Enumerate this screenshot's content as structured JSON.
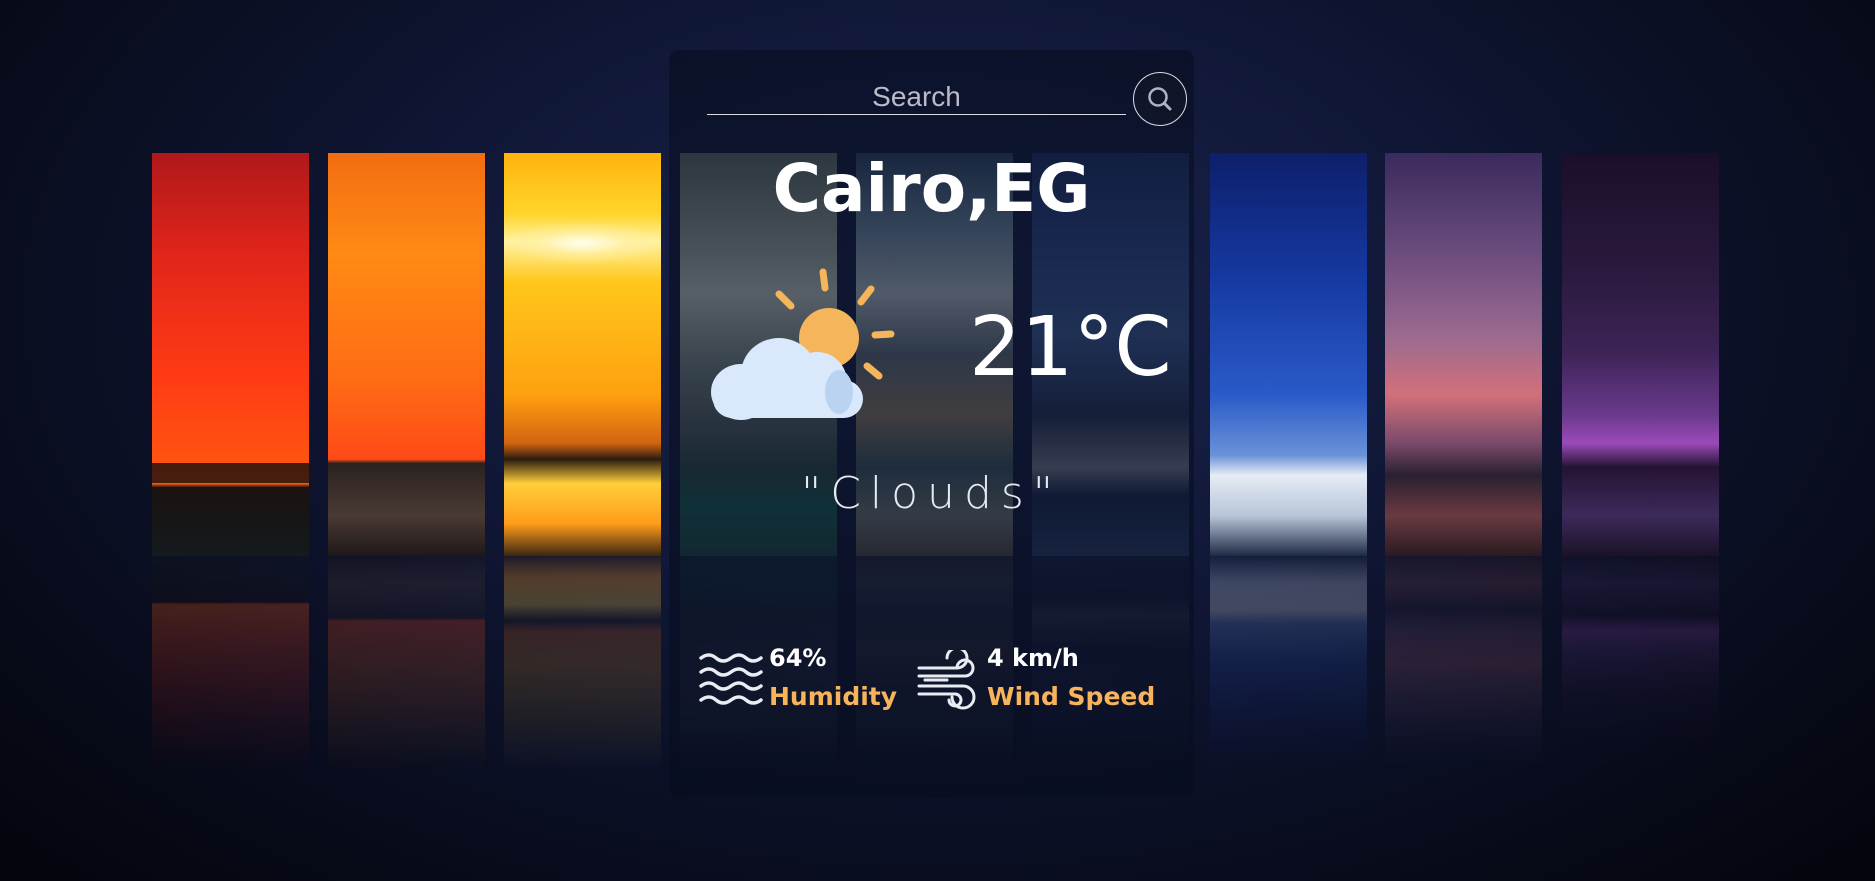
{
  "search": {
    "placeholder": "Search"
  },
  "weather": {
    "city": "Cairo,EG",
    "temperature": "21°C",
    "description": "\"Clouds\"",
    "icon": "partly-cloudy-icon"
  },
  "stats": {
    "humidity": {
      "value": "64%",
      "label": "Humidity",
      "icon": "waves-icon"
    },
    "wind": {
      "value": "4 km/h",
      "label": "Wind Speed",
      "icon": "wind-icon"
    }
  },
  "colors": {
    "accent": "#f7b45b",
    "text": "#ffffff",
    "sun": "#f5b55b",
    "cloud": "#d9e9fb"
  }
}
